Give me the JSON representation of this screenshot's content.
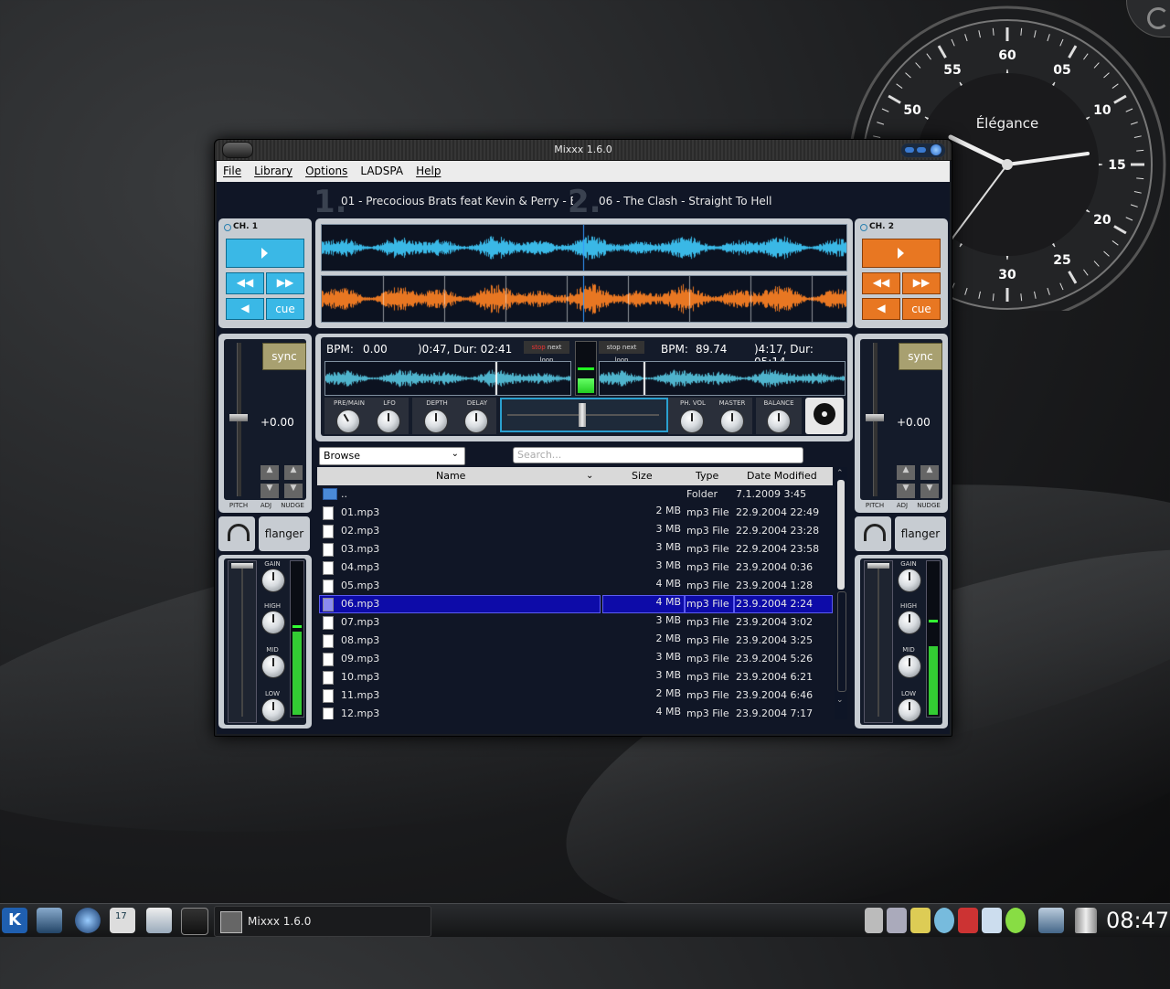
{
  "desktop": {
    "clock_brand": "Élégance",
    "clock_numbers": [
      "60",
      "05",
      "10",
      "15",
      "20",
      "25",
      "30",
      "50",
      "55"
    ]
  },
  "window": {
    "title": "Mixxx 1.6.0",
    "menu": [
      "File",
      "Library",
      "Options",
      "LADSPA",
      "Help"
    ]
  },
  "decks": {
    "deck1_number": "1.",
    "deck1_track": "01 - Precocious Brats feat Kevin & Perry - B",
    "deck2_number": "2.",
    "deck2_track": "06 - The Clash - Straight To Hell",
    "ch1_label": "CH. 1",
    "ch2_label": "CH. 2",
    "cue_label": "cue",
    "sync_label": "sync",
    "pitch_value": "+0.00",
    "pitch_label": "PITCH",
    "adj_label": "ADJ",
    "nudge_label": "NUDGE",
    "flanger_label": "flanger",
    "bpm1_label": "BPM:",
    "bpm1_value": "0.00",
    "time1": ")0:47, Dur: 02:41",
    "bpm2_label": "BPM:",
    "bpm2_value": "89.74",
    "time2": ")4:17, Dur: 05:14",
    "loop_stop": "stop",
    "loop_next": "next",
    "loop_loop": "loop",
    "eq": {
      "gain": "GAIN",
      "high": "HIGH",
      "mid": "MID",
      "low": "LOW"
    },
    "mixer_knobs": {
      "premain": "PRE/MAIN",
      "lfo": "LFO",
      "depth": "DEPTH",
      "delay": "DELAY",
      "phvol": "PH. VOL",
      "master": "MASTER",
      "balance": "BALANCE"
    },
    "vu1_level": 0.55,
    "vu2_level": 0.45,
    "master_vu_level": 0.3
  },
  "library": {
    "mode": "Browse",
    "search_placeholder": "Search...",
    "columns": [
      "Name",
      "Size",
      "Type",
      "Date Modified"
    ],
    "rows": [
      {
        "name": "..",
        "size": "",
        "type": "Folder",
        "date": "7.1.2009 3:45",
        "folder": true
      },
      {
        "name": "01.mp3",
        "size": "2 MB",
        "type": "mp3 File",
        "date": "22.9.2004 22:49"
      },
      {
        "name": "02.mp3",
        "size": "3 MB",
        "type": "mp3 File",
        "date": "22.9.2004 23:28"
      },
      {
        "name": "03.mp3",
        "size": "3 MB",
        "type": "mp3 File",
        "date": "22.9.2004 23:58"
      },
      {
        "name": "04.mp3",
        "size": "3 MB",
        "type": "mp3 File",
        "date": "23.9.2004 0:36"
      },
      {
        "name": "05.mp3",
        "size": "4 MB",
        "type": "mp3 File",
        "date": "23.9.2004 1:28"
      },
      {
        "name": "06.mp3",
        "size": "4 MB",
        "type": "mp3 File",
        "date": "23.9.2004 2:24",
        "selected": true
      },
      {
        "name": "07.mp3",
        "size": "3 MB",
        "type": "mp3 File",
        "date": "23.9.2004 3:02"
      },
      {
        "name": "08.mp3",
        "size": "2 MB",
        "type": "mp3 File",
        "date": "23.9.2004 3:25"
      },
      {
        "name": "09.mp3",
        "size": "3 MB",
        "type": "mp3 File",
        "date": "23.9.2004 5:26"
      },
      {
        "name": "10.mp3",
        "size": "3 MB",
        "type": "mp3 File",
        "date": "23.9.2004 6:21"
      },
      {
        "name": "11.mp3",
        "size": "2 MB",
        "type": "mp3 File",
        "date": "23.9.2004 6:46"
      },
      {
        "name": "12.mp3",
        "size": "4 MB",
        "type": "mp3 File",
        "date": "23.9.2004 7:17"
      }
    ]
  },
  "taskbar": {
    "task_label": "Mixxx 1.6.0",
    "clock": "08:47",
    "calendar_day": "17"
  },
  "colors": {
    "deck1": "#3ab8e6",
    "deck2": "#e87722",
    "selection": "#0d0ba8"
  }
}
